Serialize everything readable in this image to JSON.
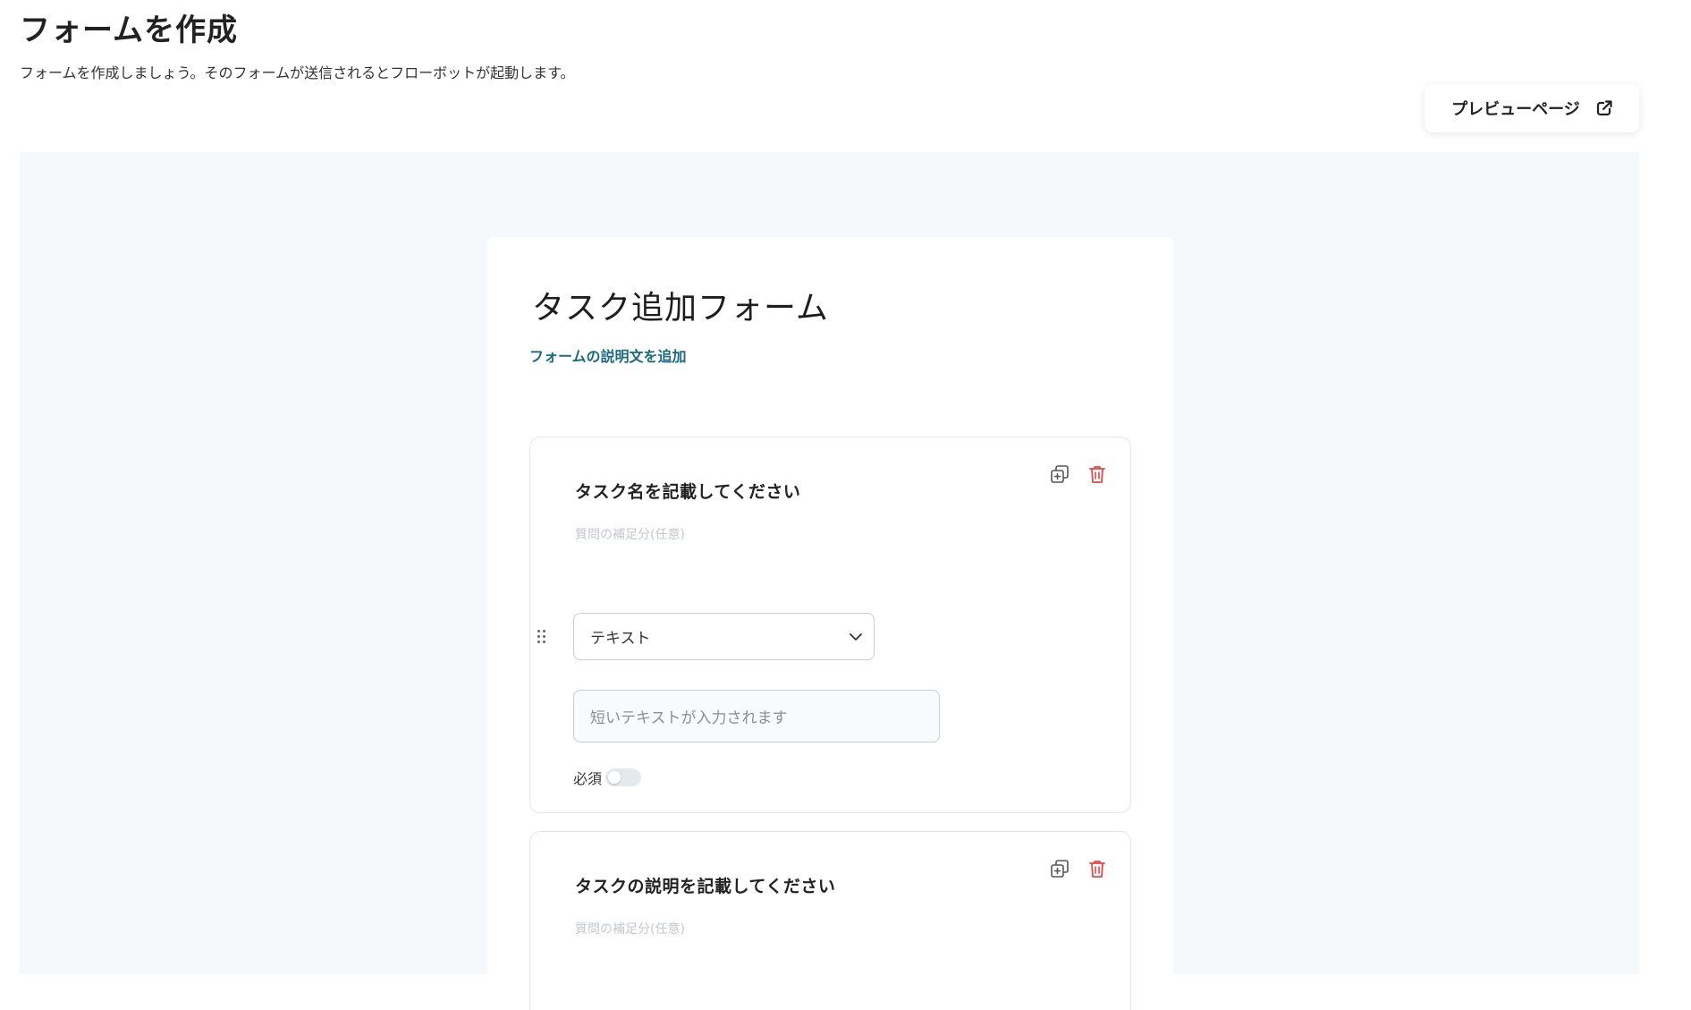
{
  "header": {
    "title": "フォームを作成",
    "subtitle": "フォームを作成しましょう。そのフォームが送信されるとフローボットが起動します。",
    "preview_button": "プレビューページ"
  },
  "form": {
    "title": "タスク追加フォーム",
    "add_description_link": "フォームの説明文を追加",
    "questions": [
      {
        "title": "タスク名を記載してください",
        "hint": "質問の補足分(任意)",
        "type": "テキスト",
        "answer_placeholder": "短いテキストが入力されます",
        "required_label": "必須",
        "required": false
      },
      {
        "title": "タスクの説明を記載してください",
        "hint": "質問の補足分(任意)"
      }
    ]
  },
  "icons": {
    "preview": "external-link-icon",
    "duplicate": "duplicate-icon",
    "delete": "trash-icon",
    "drag": "drag-handle-icon",
    "select": "chevron-down-icon"
  },
  "colors": {
    "link": "#1b6a80",
    "delete": "#e04848",
    "canvas_bg": "#f6f9fb"
  }
}
